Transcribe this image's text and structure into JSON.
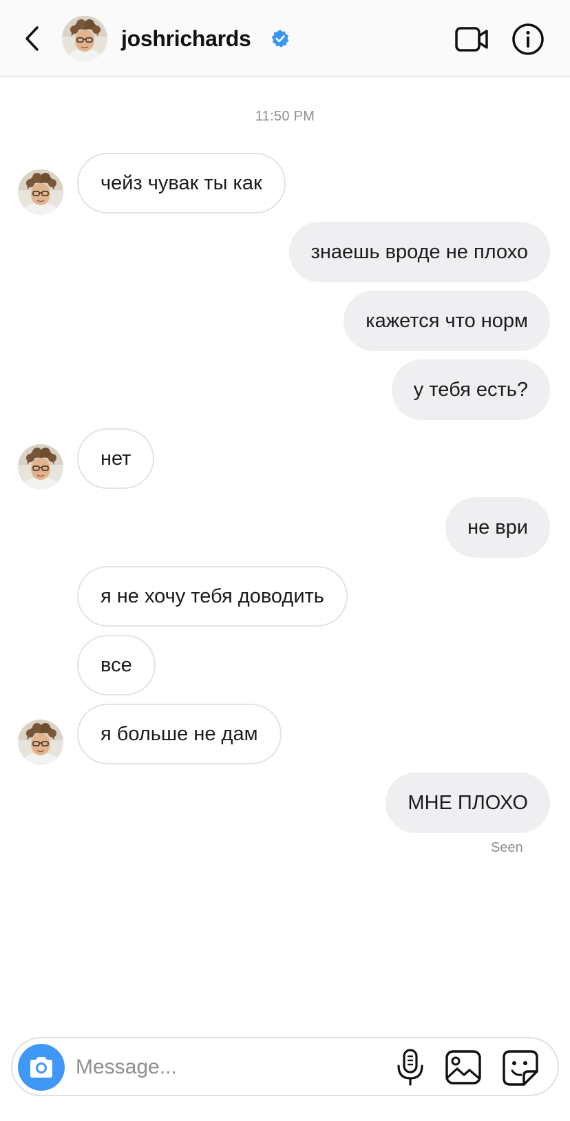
{
  "header": {
    "username": "joshrichards",
    "verified": true,
    "icons": {
      "back": "chevron-left-icon",
      "verified": "verified-badge-icon",
      "video": "video-camera-icon",
      "info": "info-icon"
    }
  },
  "conversation": {
    "timestamp": "11:50 PM",
    "messages": [
      {
        "direction": "incoming",
        "text": "чейз чувак ты как",
        "show_avatar": true
      },
      {
        "direction": "outgoing",
        "text": "знаешь вроде не плохо"
      },
      {
        "direction": "outgoing",
        "text": "кажется что норм"
      },
      {
        "direction": "outgoing",
        "text": "у тебя есть?"
      },
      {
        "direction": "incoming",
        "text": "нет",
        "show_avatar": true
      },
      {
        "direction": "outgoing",
        "text": "не ври"
      },
      {
        "direction": "incoming",
        "text": "я не хочу тебя доводить",
        "show_avatar": false
      },
      {
        "direction": "incoming",
        "text": "все",
        "show_avatar": false
      },
      {
        "direction": "incoming",
        "text": "я больше не дам",
        "show_avatar": true
      },
      {
        "direction": "outgoing",
        "text": "МНЕ ПЛОХО"
      }
    ],
    "read_receipt": "Seen"
  },
  "composer": {
    "placeholder": "Message...",
    "value": "",
    "icons": {
      "camera": "camera-icon",
      "mic": "microphone-icon",
      "gallery": "gallery-icon",
      "sticker": "sticker-icon"
    }
  },
  "colors": {
    "accent": "#3f97f6",
    "outgoing_bubble": "#efeff1",
    "incoming_border": "#e3e3e6",
    "secondary_text": "#8e8e93",
    "header_bg": "#fafafa"
  }
}
